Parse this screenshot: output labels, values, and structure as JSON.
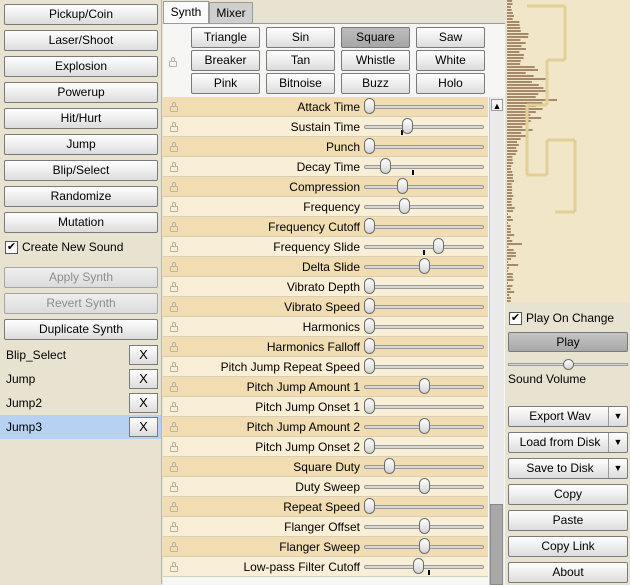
{
  "generators": [
    "Pickup/Coin",
    "Laser/Shoot",
    "Explosion",
    "Powerup",
    "Hit/Hurt",
    "Jump",
    "Blip/Select",
    "Randomize",
    "Mutation"
  ],
  "create_new_sound": {
    "label": "Create New Sound",
    "checked": true
  },
  "apply_synth": "Apply Synth",
  "revert_synth": "Revert Synth",
  "duplicate_synth": "Duplicate Synth",
  "history": [
    {
      "name": "Blip_Select",
      "active": false
    },
    {
      "name": "Jump",
      "active": false
    },
    {
      "name": "Jump2",
      "active": false
    },
    {
      "name": "Jump3",
      "active": true
    }
  ],
  "history_remove_label": "X",
  "check_mark": "✔",
  "tabs": [
    {
      "label": "Synth",
      "active": true
    },
    {
      "label": "Mixer",
      "active": false
    }
  ],
  "waveforms": [
    "Triangle",
    "Sin",
    "Square",
    "Saw",
    "Breaker",
    "Tan",
    "Whistle",
    "White",
    "Pink",
    "Bitnoise",
    "Buzz",
    "Holo"
  ],
  "selected_waveform": "Square",
  "scroll_up_glyph": "▲",
  "params": [
    {
      "label": "Attack Time",
      "value": 0.0
    },
    {
      "label": "Sustain Time",
      "value": 0.35,
      "default": 0.3
    },
    {
      "label": "Punch",
      "value": 0.0
    },
    {
      "label": "Decay Time",
      "value": 0.15,
      "default": 0.4
    },
    {
      "label": "Compression",
      "value": 0.3
    },
    {
      "label": "Frequency",
      "value": 0.32
    },
    {
      "label": "Frequency Cutoff",
      "value": 0.0
    },
    {
      "label": "Frequency Slide",
      "value": 0.63,
      "default": 0.5
    },
    {
      "label": "Delta Slide",
      "value": 0.5
    },
    {
      "label": "Vibrato Depth",
      "value": 0.0
    },
    {
      "label": "Vibrato Speed",
      "value": 0.0
    },
    {
      "label": "Harmonics",
      "value": 0.0
    },
    {
      "label": "Harmonics Falloff",
      "value": 0.0
    },
    {
      "label": "Pitch Jump Repeat Speed",
      "value": 0.0
    },
    {
      "label": "Pitch Jump Amount 1",
      "value": 0.5
    },
    {
      "label": "Pitch Jump Onset 1",
      "value": 0.0
    },
    {
      "label": "Pitch Jump Amount 2",
      "value": 0.5
    },
    {
      "label": "Pitch Jump Onset 2",
      "value": 0.0
    },
    {
      "label": "Square Duty",
      "value": 0.18
    },
    {
      "label": "Duty Sweep",
      "value": 0.5
    },
    {
      "label": "Repeat Speed",
      "value": 0.0
    },
    {
      "label": "Flanger Offset",
      "value": 0.5
    },
    {
      "label": "Flanger Sweep",
      "value": 0.5
    },
    {
      "label": "Low-pass Filter Cutoff",
      "value": 0.45,
      "default": 0.55
    }
  ],
  "play_on_change": {
    "label": "Play On Change",
    "checked": true
  },
  "play": "Play",
  "sound_volume": {
    "label": "Sound Volume",
    "value": 0.5
  },
  "export_wav": "Export Wav",
  "load_from_disk": "Load from Disk",
  "save_to_disk": "Save to Disk",
  "dropdown_glyph": "▼",
  "copy": "Copy",
  "paste": "Paste",
  "copy_link": "Copy Link",
  "about": "About",
  "colors": {
    "background": "#e8e2d0",
    "row_odd": "#f2ddb2",
    "row_even": "#f8efd6",
    "history_selected": "#b6d1f2",
    "waveform_bars": "#a6886a"
  }
}
